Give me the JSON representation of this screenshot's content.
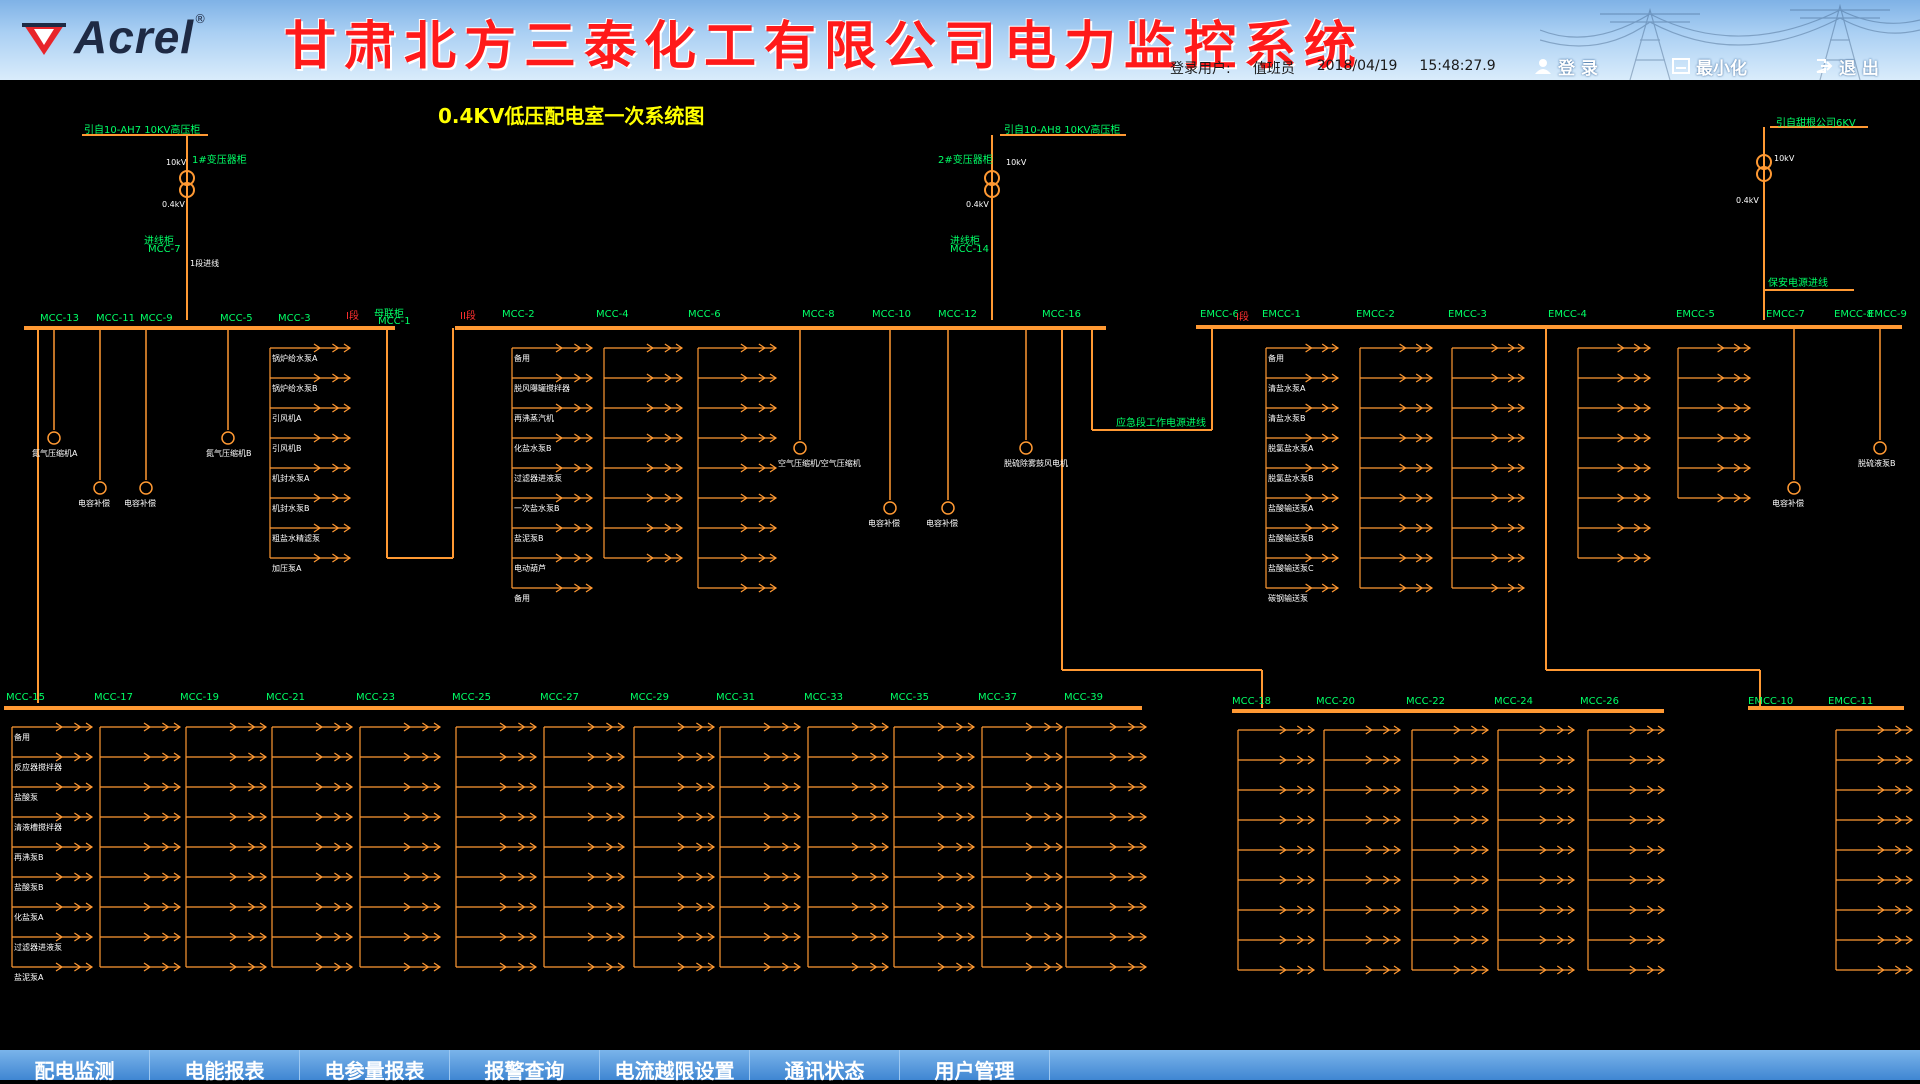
{
  "header": {
    "logo_text": "Acrel",
    "logo_reg": "®",
    "app_title": "甘肃北方三泰化工有限公司电力监控系统",
    "login_user_label": "登录用户:",
    "login_user": "值班员",
    "date": "2018/04/19",
    "time": "15:48:27.9",
    "login_button": "登 录",
    "minimize_button": "最小化",
    "exit_button": "退 出"
  },
  "diagram": {
    "title": "0.4KV低压配电室一次系统图",
    "incoming": [
      {
        "label": "引自10-AH7 10KV高压柜",
        "transformer": "1#变压器柜",
        "hv": "10kV",
        "lv": "0.4kV",
        "incomer": "进线柜",
        "incomer_code": "MCC-7",
        "incomer_note": "1段进线"
      },
      {
        "label": "引自10-AH8 10KV高压柜",
        "transformer": "2#变压器柜",
        "hv": "10kV",
        "lv": "0.4kV",
        "incomer": "进线柜",
        "incomer_code": "MCC-14"
      },
      {
        "label": "引自甜根公司6KV",
        "hv": "10kV",
        "lv": "0.4kV",
        "incomer": "保安电源进线"
      }
    ],
    "section_1": "I段",
    "section_2": "II段",
    "section_3": "I段",
    "bus_tie": "母联柜",
    "bus_tie_code": "MCC-1",
    "emergency_feed": "应急段工作电源进线",
    "top_cabinets_left": [
      "MCC-13",
      "MCC-11",
      "MCC-9",
      "MCC-5",
      "MCC-3"
    ],
    "top_cabinets_mid": [
      "MCC-2",
      "MCC-4",
      "MCC-6",
      "MCC-8",
      "MCC-10",
      "MCC-12",
      "MCC-16"
    ],
    "top_cabinets_right": [
      "EMCC-6",
      "EMCC-1",
      "EMCC-2",
      "EMCC-3",
      "EMCC-4",
      "EMCC-5",
      "EMCC-7",
      "EMCC-8",
      "EMCC-9"
    ],
    "bottom_cabinets_left": [
      "MCC-15",
      "MCC-17",
      "MCC-19",
      "MCC-21",
      "MCC-23",
      "MCC-25",
      "MCC-27",
      "MCC-29",
      "MCC-31",
      "MCC-33",
      "MCC-35",
      "MCC-37",
      "MCC-39"
    ],
    "bottom_cabinets_right": [
      "MCC-18",
      "MCC-20",
      "MCC-22",
      "MCC-24",
      "MCC-26",
      "EMCC-10",
      "EMCC-11"
    ],
    "single_loads": [
      "氮气压缩机A",
      "电容补偿",
      "电容补偿",
      "氮气压缩机B",
      "空气压缩机/空气压缩机",
      "电容补偿",
      "电容补偿",
      "脱硫除雾鼓风电机",
      "电容补偿",
      "脱硫液泵B"
    ],
    "feeder_samples_mcc3": [
      "锅炉给水泵A",
      "锅炉给水泵B",
      "引风机A",
      "引风机B",
      "机封水泵A",
      "机封水泵B",
      "粗盐水精滤泵",
      "加压泵A"
    ],
    "feeder_samples_mcc2": [
      "备用",
      "脱风曝罐搅拌器",
      "再沸蒸汽机",
      "化盐水泵B",
      "过滤器进液泵",
      "一次盐水泵B",
      "盐泥泵B",
      "电动葫芦",
      "备用"
    ],
    "feeder_samples_emcc1": [
      "备用",
      "清盐水泵A",
      "清盐水泵B",
      "脱氯盐水泵A",
      "脱氯盐水泵B",
      "盐酸输送泵A",
      "盐酸输送泵B",
      "盐酸输送泵C",
      "碳钢输送泵"
    ],
    "feeder_samples_mcc15": [
      "备用",
      "反应器搅拌器",
      "盐酸泵",
      "清液槽搅拌器",
      "再沸泵B",
      "盐酸泵B",
      "化盐泵A",
      "过滤器进液泵",
      "盐泥泵A"
    ]
  },
  "nav": [
    "配电监测",
    "电能报表",
    "电参量报表",
    "报警查询",
    "电流越限设置",
    "通讯状态",
    "用户管理"
  ]
}
